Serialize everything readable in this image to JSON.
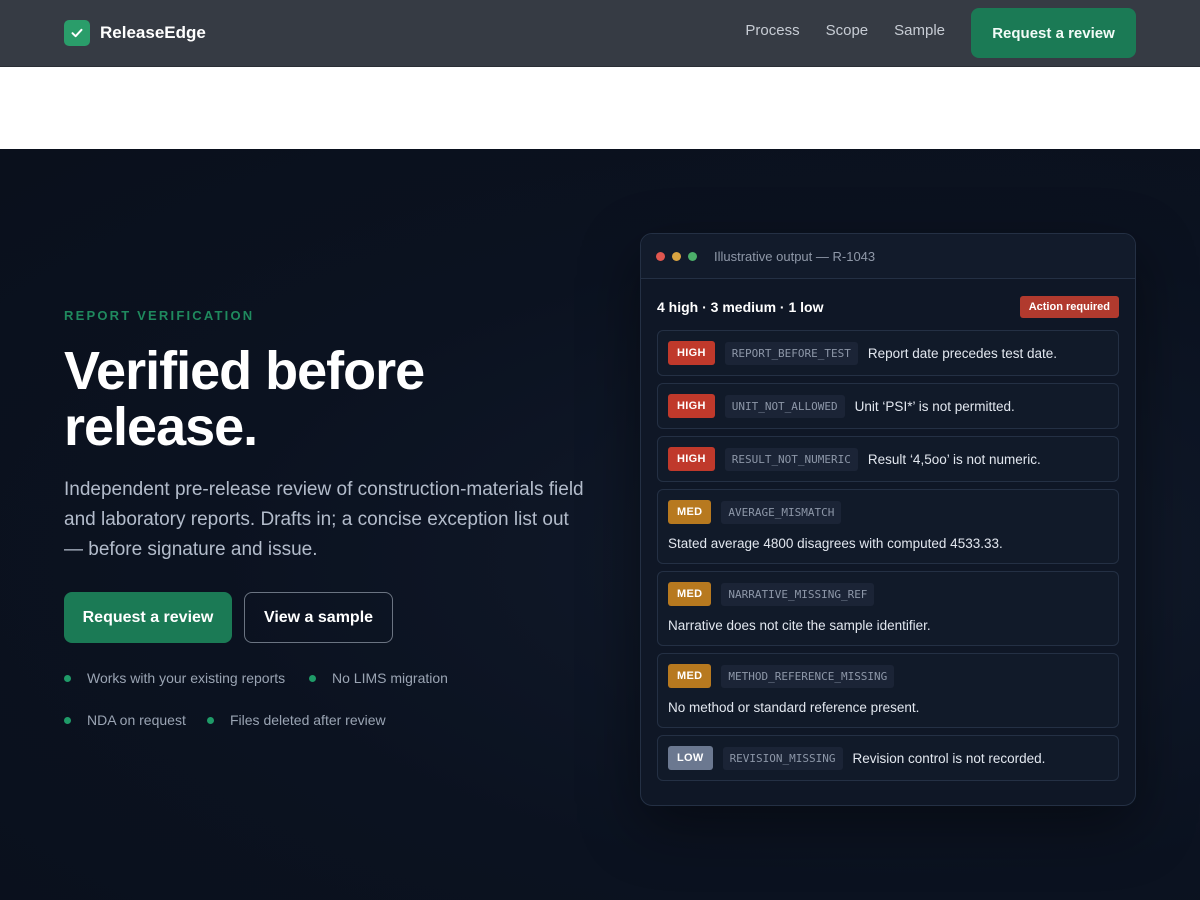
{
  "nav": {
    "brand": "ReleaseEdge",
    "links": [
      "Process",
      "Scope",
      "Sample"
    ],
    "cta": "Request a review"
  },
  "hero": {
    "eyebrow": "REPORT VERIFICATION",
    "headline": "Verified before release.",
    "lead": "Independent pre-release review of construction-materials field and laboratory reports. Drafts in; a concise exception list out — before signature and issue.",
    "primary_button": "Request a review",
    "secondary_button": "View a sample",
    "features": [
      "Works with your existing reports",
      "No LIMS migration",
      "NDA on request",
      "Files deleted after review"
    ]
  },
  "panel": {
    "title": "Illustrative output — R-1043",
    "summary": "4 high · 3 medium · 1 low",
    "action": "Action required",
    "issues": [
      {
        "severity": "HIGH",
        "code": "REPORT_BEFORE_TEST",
        "message": "Report date precedes test date."
      },
      {
        "severity": "HIGH",
        "code": "UNIT_NOT_ALLOWED",
        "message": "Unit ‘PSI*’ is not permitted."
      },
      {
        "severity": "HIGH",
        "code": "RESULT_NOT_NUMERIC",
        "message": "Result ‘4,5oo’ is not numeric."
      },
      {
        "severity": "MED",
        "code": "AVERAGE_MISMATCH",
        "message": "Stated average 4800 disagrees with computed 4533.33."
      },
      {
        "severity": "MED",
        "code": "NARRATIVE_MISSING_REF",
        "message": "Narrative does not cite the sample identifier."
      },
      {
        "severity": "MED",
        "code": "METHOD_REFERENCE_MISSING",
        "message": "No method or standard reference present."
      },
      {
        "severity": "LOW",
        "code": "REVISION_MISSING",
        "message": "Revision control is not recorded."
      }
    ]
  },
  "colors": {
    "accent": "#1b7a55",
    "high": "#c0392b",
    "medium": "#b7791f",
    "low": "#6b7890",
    "hero_bg": "#0b1220"
  }
}
